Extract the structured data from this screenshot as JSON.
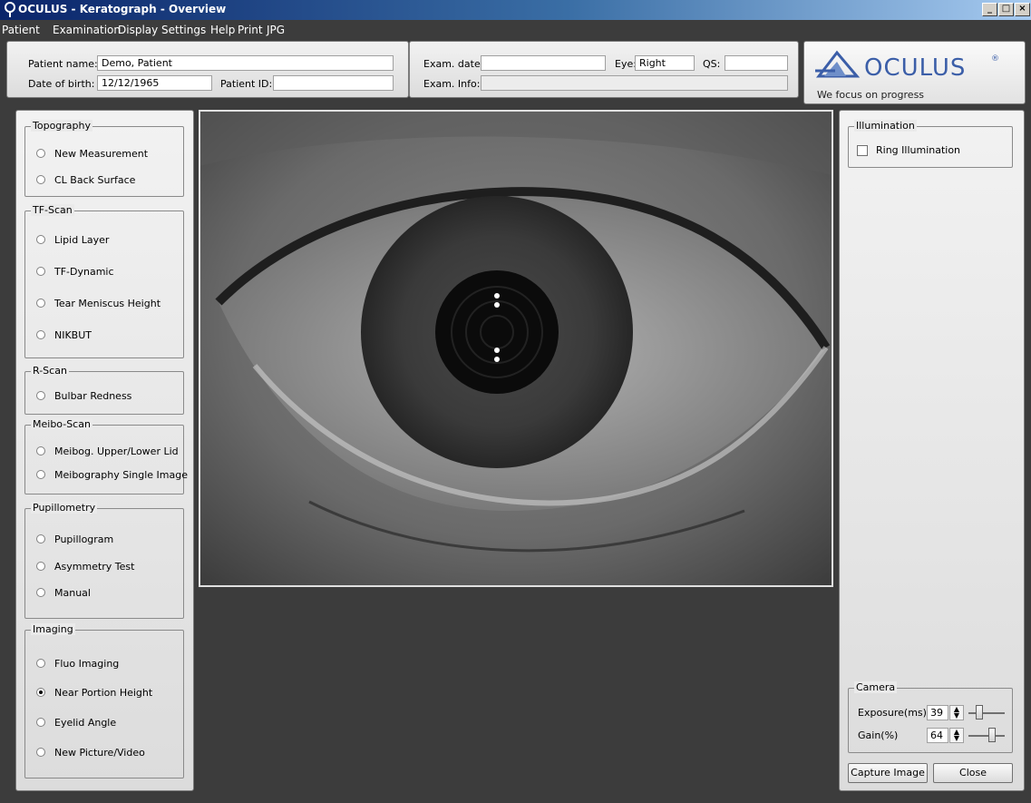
{
  "window": {
    "title": "OCULUS - Keratograph - Overview",
    "buttons": {
      "minimize": "_",
      "maximize": "□",
      "close": "×"
    }
  },
  "menu": [
    "Patient",
    "Examination",
    "Display",
    "Settings",
    "Help",
    "Print",
    "JPG"
  ],
  "patient": {
    "name_label": "Patient name:",
    "name_value": "Demo, Patient",
    "dob_label": "Date of birth:",
    "dob_value": "12/12/1965",
    "id_label": "Patient ID:",
    "id_value": ""
  },
  "exam": {
    "date_label": "Exam. date:",
    "date_value": "",
    "eye_label": "Eye:",
    "eye_value": "Right",
    "qs_label": "QS:",
    "qs_value": "",
    "info_label": "Exam. Info:",
    "info_value": ""
  },
  "logo": {
    "brand": "OCULUS",
    "registered": "®",
    "tagline": "We focus on progress"
  },
  "left_panel": {
    "groups": [
      {
        "label": "Topography",
        "items": [
          "New Measurement",
          "CL Back Surface"
        ]
      },
      {
        "label": "TF-Scan",
        "items": [
          "Lipid Layer",
          "TF-Dynamic",
          "Tear Meniscus Height",
          "NIKBUT"
        ]
      },
      {
        "label": "R-Scan",
        "items": [
          "Bulbar Redness"
        ]
      },
      {
        "label": "Meibo-Scan",
        "items": [
          "Meibog. Upper/Lower Lid",
          "Meibography Single Image"
        ]
      },
      {
        "label": "Pupillometry",
        "items": [
          "Pupillogram",
          "Asymmetry Test",
          "Manual"
        ]
      },
      {
        "label": "Imaging",
        "items": [
          "Fluo Imaging",
          "Near Portion Height",
          "Eyelid Angle",
          "New Picture/Video"
        ]
      }
    ],
    "selected": "Near Portion Height"
  },
  "right_panel": {
    "illumination": {
      "label": "Illumination",
      "ring_label": "Ring Illumination",
      "ring_checked": false
    },
    "camera": {
      "label": "Camera",
      "exposure_label": "Exposure(ms)",
      "exposure_value": "39",
      "gain_label": "Gain(%)",
      "gain_value": "64"
    },
    "capture_button": "Capture Image",
    "close_button": "Close"
  },
  "colors": {
    "background": "#3c3c3c",
    "logo_blue": "#3b5ea8"
  }
}
